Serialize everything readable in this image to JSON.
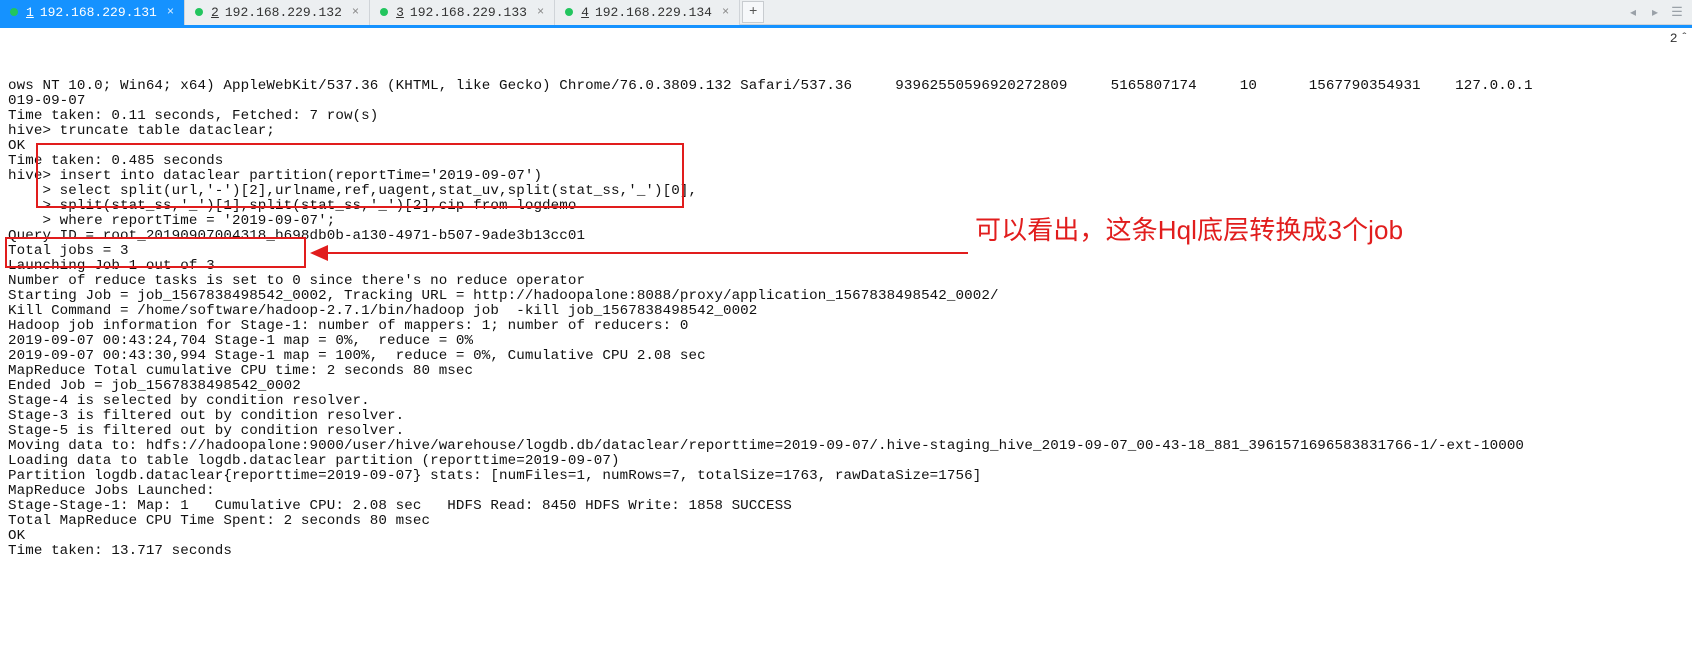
{
  "tabs": [
    {
      "num": "1",
      "label": "192.168.229.131",
      "active": true
    },
    {
      "num": "2",
      "label": "192.168.229.132",
      "active": false
    },
    {
      "num": "3",
      "label": "192.168.229.133",
      "active": false
    },
    {
      "num": "4",
      "label": "192.168.229.134",
      "active": false
    }
  ],
  "tab_add_label": "+",
  "scroll_indicator": "2",
  "annotation_text": "可以看出，这条Hql底层转换成3个job",
  "terminal_lines": [
    "ows NT 10.0; Win64; x64) AppleWebKit/537.36 (KHTML, like Gecko) Chrome/76.0.3809.132 Safari/537.36     93962550596920272809     5165807174     10      1567790354931    127.0.0.1",
    "019-09-07",
    "Time taken: 0.11 seconds, Fetched: 7 row(s)",
    "hive> truncate table dataclear;",
    "OK",
    "Time taken: 0.485 seconds",
    "hive> insert into dataclear partition(reportTime='2019-09-07')",
    "    > select split(url,'-')[2],urlname,ref,uagent,stat_uv,split(stat_ss,'_')[0],",
    "    > split(stat_ss,'_')[1],split(stat_ss,'_')[2],cip from logdemo",
    "    > where reportTime = '2019-09-07';",
    "Query ID = root_20190907004318_b698db0b-a130-4971-b507-9ade3b13cc01",
    "Total jobs = 3",
    "Launching Job 1 out of 3",
    "Number of reduce tasks is set to 0 since there's no reduce operator",
    "Starting Job = job_1567838498542_0002, Tracking URL = http://hadoopalone:8088/proxy/application_1567838498542_0002/",
    "Kill Command = /home/software/hadoop-2.7.1/bin/hadoop job  -kill job_1567838498542_0002",
    "Hadoop job information for Stage-1: number of mappers: 1; number of reducers: 0",
    "2019-09-07 00:43:24,704 Stage-1 map = 0%,  reduce = 0%",
    "2019-09-07 00:43:30,994 Stage-1 map = 100%,  reduce = 0%, Cumulative CPU 2.08 sec",
    "MapReduce Total cumulative CPU time: 2 seconds 80 msec",
    "Ended Job = job_1567838498542_0002",
    "Stage-4 is selected by condition resolver.",
    "Stage-3 is filtered out by condition resolver.",
    "Stage-5 is filtered out by condition resolver.",
    "Moving data to: hdfs://hadoopalone:9000/user/hive/warehouse/logdb.db/dataclear/reporttime=2019-09-07/.hive-staging_hive_2019-09-07_00-43-18_881_3961571696583831766-1/-ext-10000",
    "Loading data to table logdb.dataclear partition (reporttime=2019-09-07)",
    "Partition logdb.dataclear{reporttime=2019-09-07} stats: [numFiles=1, numRows=7, totalSize=1763, rawDataSize=1756]",
    "MapReduce Jobs Launched:",
    "Stage-Stage-1: Map: 1   Cumulative CPU: 2.08 sec   HDFS Read: 8450 HDFS Write: 1858 SUCCESS",
    "Total MapReduce CPU Time Spent: 2 seconds 80 msec",
    "OK",
    "Time taken: 13.717 seconds"
  ]
}
